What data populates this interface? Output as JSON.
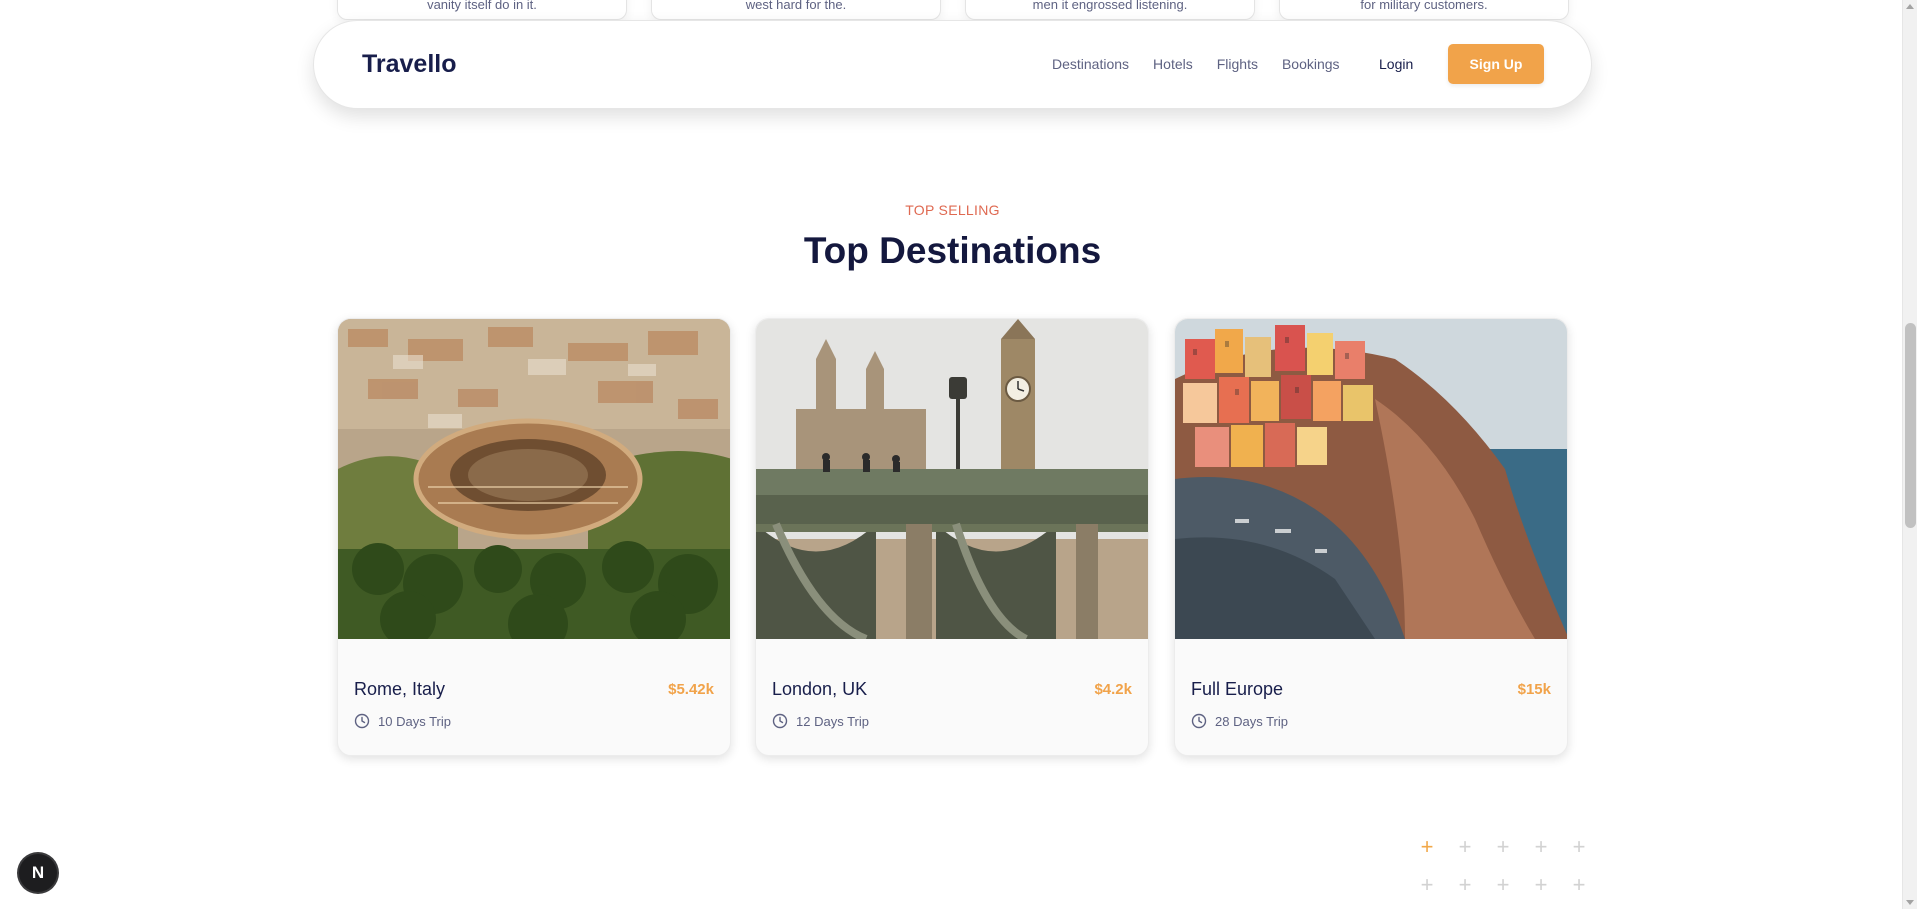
{
  "services": [
    {
      "text": "vanity itself do in it."
    },
    {
      "text": "west hard for the."
    },
    {
      "text": "men it engrossed listening."
    },
    {
      "text": "for military customers."
    }
  ],
  "navbar": {
    "brand": "Travello",
    "links": [
      "Destinations",
      "Hotels",
      "Flights",
      "Bookings"
    ],
    "login_label": "Login",
    "signup_label": "Sign Up"
  },
  "section": {
    "eyebrow": "TOP SELLING",
    "title": "Top Destinations"
  },
  "destinations": [
    {
      "name": "Rome, Italy",
      "price": "$5.42k",
      "duration": "10 Days Trip",
      "image": "colosseum-aerial-photo"
    },
    {
      "name": "London, UK",
      "price": "$4.2k",
      "duration": "12 Days Trip",
      "image": "big-ben-westminster-bridge-photo"
    },
    {
      "name": "Full Europe",
      "price": "$15k",
      "duration": "28 Days Trip",
      "image": "cinque-terre-cliff-village-photo"
    }
  ],
  "dev_badge": "N",
  "colors": {
    "accent": "#f1a34a",
    "eyebrow": "#df6951",
    "heading": "#14183e",
    "muted": "#5e6282"
  },
  "icons": [
    "clock-icon",
    "plus-icon"
  ]
}
